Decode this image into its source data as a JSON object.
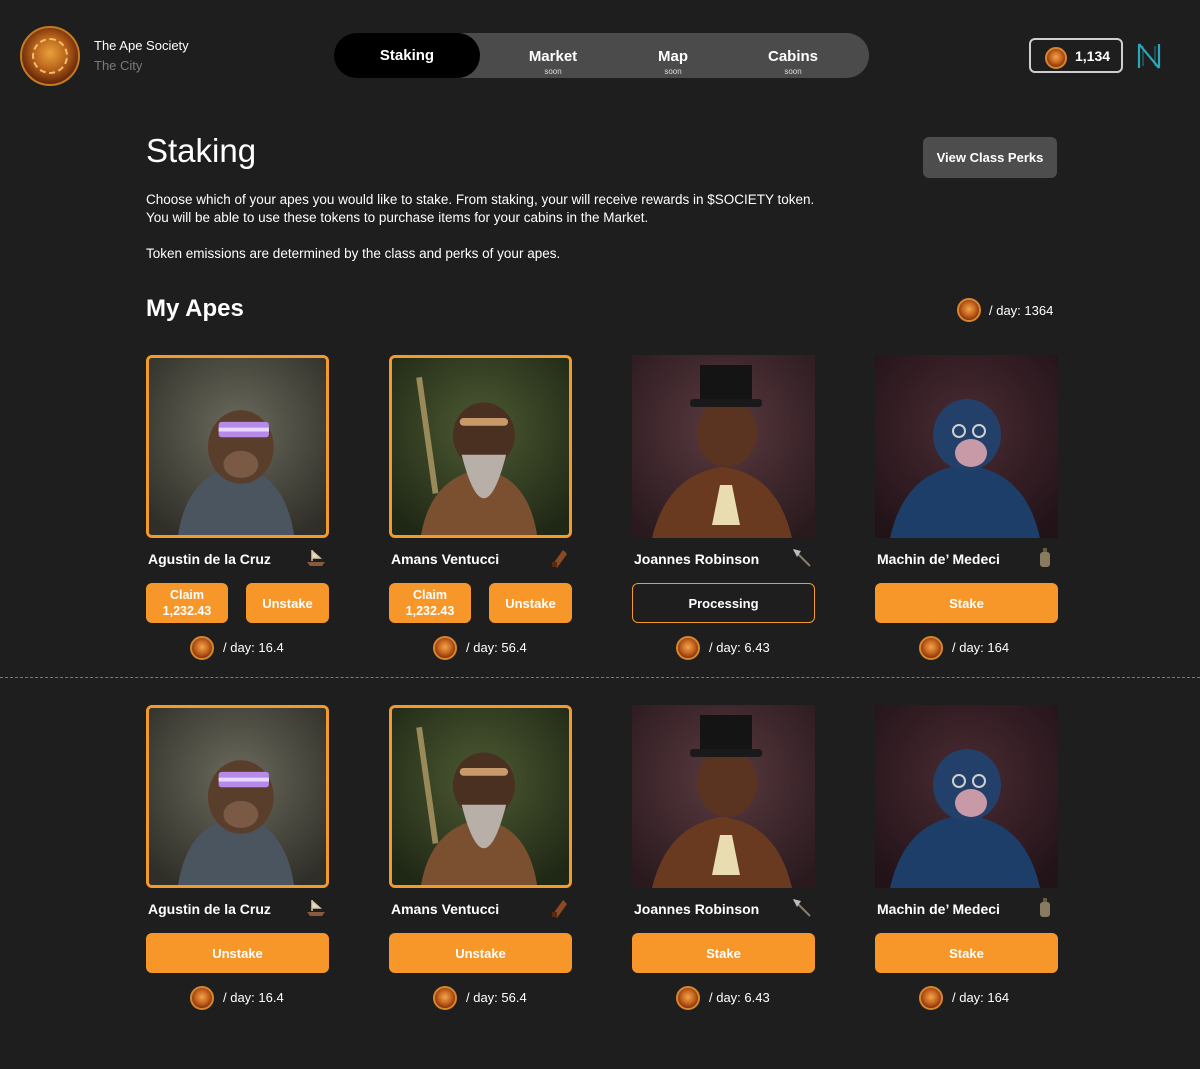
{
  "header": {
    "brand_name": "The Ape Society",
    "brand_sub": "The City",
    "tabs": [
      {
        "label": "Staking",
        "soon": ""
      },
      {
        "label": "Market",
        "soon": "soon"
      },
      {
        "label": "Map",
        "soon": "soon"
      },
      {
        "label": "Cabins",
        "soon": "soon"
      }
    ],
    "balance": "1,134",
    "accent": "#f7972a"
  },
  "intro": {
    "title": "Staking",
    "perks_button": "View Class Perks",
    "paragraph1": "Choose which of your apes you would like to stake.  From staking, your will receive rewards in $SOCIETY token.  You will be able to use these tokens to purchase items for your cabins in the Market.",
    "paragraph2": "Token emissions are determined by the class and perks of your apes."
  },
  "apes_section": {
    "title": "My Apes",
    "total_rate": "/ day: 1364"
  },
  "rows": [
    {
      "cards": [
        {
          "name": "Agustin de la Cruz",
          "class_icon": "ship-icon",
          "claim_label": "Claim",
          "claim_amount": "1,232.43",
          "action": "Unstake",
          "rate": "/ day: 16.4"
        },
        {
          "name": "Amans Ventucci",
          "class_icon": "scroll-icon",
          "claim_label": "Claim",
          "claim_amount": "1,232.43",
          "action": "Unstake",
          "rate": "/ day: 56.4"
        },
        {
          "name": "Joannes Robinson",
          "class_icon": "axe-icon",
          "action": "Processing",
          "rate": "/ day: 6.43"
        },
        {
          "name": "Machin de’ Medeci",
          "class_icon": "lantern-icon",
          "action": "Stake",
          "rate": "/ day: 164"
        }
      ]
    },
    {
      "cards": [
        {
          "name": "Agustin de la Cruz",
          "class_icon": "ship-icon",
          "action": "Unstake",
          "rate": "/ day: 16.4"
        },
        {
          "name": "Amans Ventucci",
          "class_icon": "scroll-icon",
          "action": "Unstake",
          "rate": "/ day: 56.4"
        },
        {
          "name": "Joannes Robinson",
          "class_icon": "axe-icon",
          "action": "Stake",
          "rate": "/ day: 6.43"
        },
        {
          "name": "Machin de’ Medeci",
          "class_icon": "lantern-icon",
          "action": "Stake",
          "rate": "/ day: 164"
        }
      ]
    }
  ]
}
